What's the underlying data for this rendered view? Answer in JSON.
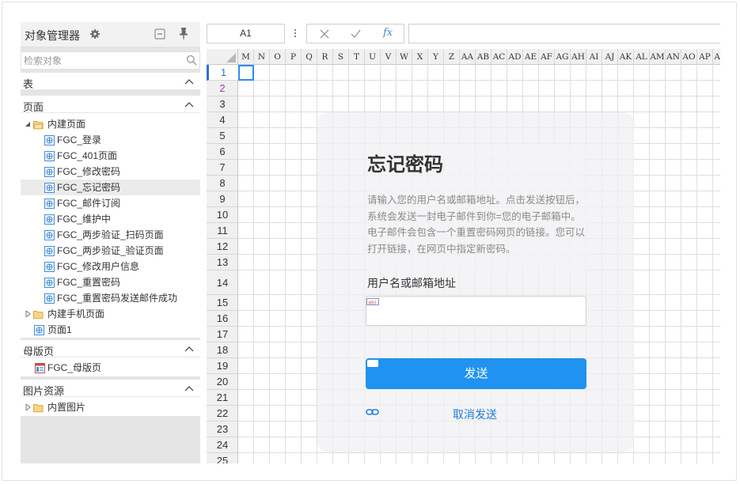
{
  "object_manager": {
    "title": "对象管理器",
    "search_placeholder": "检索对象",
    "sections": {
      "tables": {
        "label": "表"
      },
      "pages": {
        "label": "页面"
      },
      "masters": {
        "label": "母版页"
      },
      "images": {
        "label": "图片资源"
      }
    },
    "page_tree": {
      "builtin_folder": "内建页面",
      "builtin_items": [
        "FGC_登录",
        "FGC_401页面",
        "FGC_修改密码",
        "FGC_忘记密码",
        "FGC_邮件订阅",
        "FGC_维护中",
        "FGC_两步验证_扫码页面",
        "FGC_两步验证_验证页面",
        "FGC_修改用户信息",
        "FGC_重置密码",
        "FGC_重置密码发送邮件成功"
      ],
      "selected_index": 3,
      "mobile_folder": "内建手机页面",
      "page1": "页面1"
    },
    "master_item": "FGC_母版页",
    "image_folder": "内置图片"
  },
  "formula_bar": {
    "cell_ref": "A1",
    "fx_label": "fx",
    "formula": ""
  },
  "grid": {
    "columns": [
      "M",
      "N",
      "O",
      "P",
      "Q",
      "R",
      "S",
      "T",
      "U",
      "V",
      "W",
      "X",
      "Y",
      "Z",
      "AA",
      "AB",
      "AC",
      "AD",
      "AE",
      "AF",
      "AG",
      "AH",
      "AI",
      "AJ",
      "AK",
      "AL",
      "AM",
      "AN",
      "AO",
      "AP",
      "AQ"
    ],
    "rows": [
      "1",
      "2",
      "3",
      "4",
      "5",
      "6",
      "7",
      "8",
      "9",
      "10",
      "11",
      "12",
      "13",
      "14",
      "15",
      "16",
      "17",
      "18",
      "19",
      "20",
      "21",
      "22",
      "23",
      "24",
      "25"
    ],
    "active_row": "1"
  },
  "form": {
    "title": "忘记密码",
    "description": "请输入您的用户名或邮箱地址。点击发送按钮后，系统会发送一封电子邮件到你=您的电子邮箱中。电子邮件会包含一个重置密码网页的链接。您可以打开链接，在网页中指定新密码。",
    "field_label": "用户名或邮箱地址",
    "field_value": "",
    "send_label": "发送",
    "cancel_label": "取消发送"
  },
  "colors": {
    "accent": "#1f93ef",
    "link": "#1f7bd8",
    "selection": "#2f8cf0"
  }
}
